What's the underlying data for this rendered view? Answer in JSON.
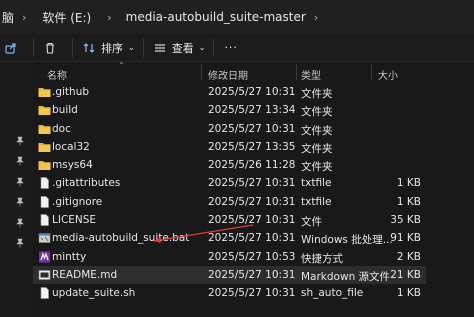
{
  "breadcrumb": [
    "脑",
    "软件 (E:)",
    "media-autobuild_suite-master"
  ],
  "toolbar": {
    "sort_label": "排序",
    "view_label": "查看",
    "more_label": "···"
  },
  "columns": {
    "name": "名称",
    "date": "修改日期",
    "type": "类型",
    "size": "大小"
  },
  "rows": [
    {
      "name": ".github",
      "date": "2025/5/27 10:31",
      "type": "文件夹",
      "size": "",
      "icon": "folder-icon"
    },
    {
      "name": "build",
      "date": "2025/5/27 13:34",
      "type": "文件夹",
      "size": "",
      "icon": "folder-icon"
    },
    {
      "name": "doc",
      "date": "2025/5/27 10:31",
      "type": "文件夹",
      "size": "",
      "icon": "folder-icon"
    },
    {
      "name": "local32",
      "date": "2025/5/27 13:35",
      "type": "文件夹",
      "size": "",
      "icon": "folder-icon"
    },
    {
      "name": "msys64",
      "date": "2025/5/26 11:28",
      "type": "文件夹",
      "size": "",
      "icon": "folder-icon"
    },
    {
      "name": ".gitattributes",
      "date": "2025/5/27 10:31",
      "type": "txtfile",
      "size": "1 KB",
      "icon": "file-icon"
    },
    {
      "name": ".gitignore",
      "date": "2025/5/27 10:31",
      "type": "txtfile",
      "size": "1 KB",
      "icon": "file-icon"
    },
    {
      "name": "LICENSE",
      "date": "2025/5/27 10:31",
      "type": "文件",
      "size": "35 KB",
      "icon": "file-icon"
    },
    {
      "name": "media-autobuild_suite.bat",
      "date": "2025/5/27 10:31",
      "type": "Windows 批处理...",
      "size": "91 KB",
      "icon": "bat-icon"
    },
    {
      "name": "mintty",
      "date": "2025/5/27 10:53",
      "type": "快捷方式",
      "size": "2 KB",
      "icon": "mintty-icon"
    },
    {
      "name": "README.md",
      "date": "2025/5/27 10:31",
      "type": "Markdown 源文件",
      "size": "21 KB",
      "icon": "markdown-icon"
    },
    {
      "name": "update_suite.sh",
      "date": "2025/5/27 10:31",
      "type": "sh_auto_file",
      "size": "1 KB",
      "icon": "file-icon"
    }
  ],
  "selected_row": 10,
  "colors": {
    "folder": "#e8b53e",
    "arrow": "#e53935",
    "selected": "#2d2d2d"
  }
}
